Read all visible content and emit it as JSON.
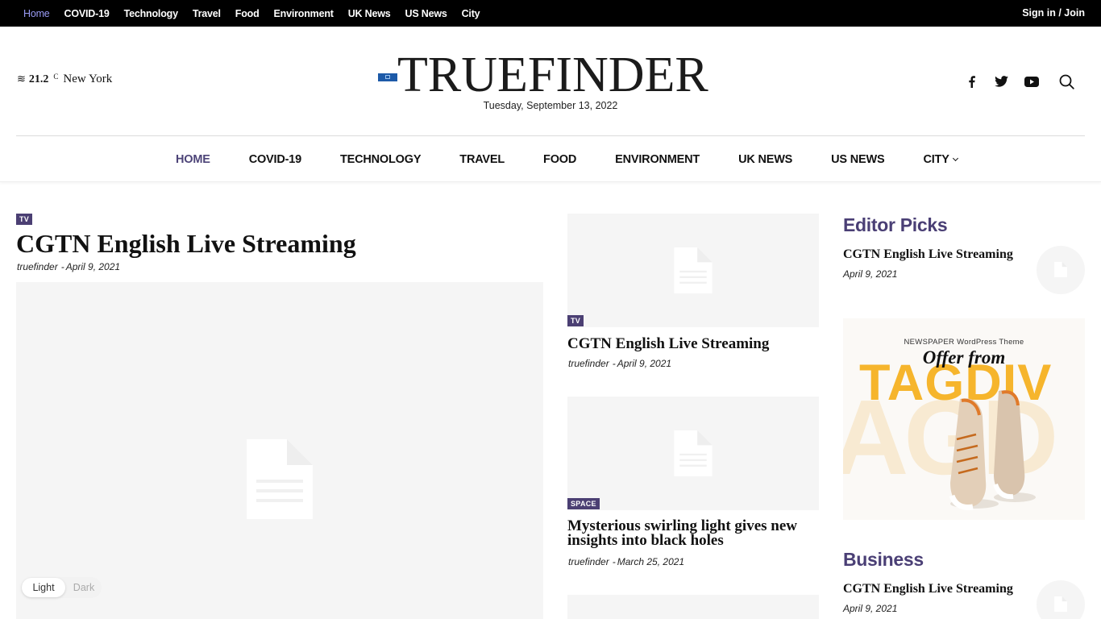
{
  "topbar": {
    "menu": [
      "Home",
      "COVID-19",
      "Technology",
      "Travel",
      "Food",
      "Environment",
      "UK News",
      "US News",
      "City"
    ],
    "signin": "Sign in / Join"
  },
  "header": {
    "weather": {
      "temp": "21.2",
      "unit": "C",
      "city": "New York",
      "icon": "wind-waves-icon"
    },
    "logo": "TRUEFINDER",
    "date": "Tuesday, September 13, 2022",
    "social": [
      "facebook-icon",
      "twitter-icon",
      "youtube-icon",
      "search-icon"
    ]
  },
  "nav": {
    "items": [
      "HOME",
      "COVID-19",
      "TECHNOLOGY",
      "TRAVEL",
      "FOOD",
      "ENVIRONMENT",
      "UK NEWS",
      "US NEWS",
      "CITY"
    ]
  },
  "featured": {
    "tag": "TV",
    "title": "CGTN English Live Streaming",
    "author": "truefinder",
    "date": "April 9, 2021"
  },
  "middle": [
    {
      "tag": "TV",
      "title": "CGTN English Live Streaming",
      "author": "truefinder",
      "date": "April 9, 2021"
    },
    {
      "tag": "SPACE",
      "title": "Mysterious swirling light gives new insights into black holes",
      "author": "truefinder",
      "date": "March 25, 2021"
    }
  ],
  "sidebar": {
    "editor_picks": {
      "heading": "Editor Picks",
      "title": "CGTN English Live Streaming",
      "date": "April 9, 2021"
    },
    "ad": {
      "small": "NEWSPAPER WordPress Theme",
      "offer": "Offer from",
      "brand": "TAGDIV",
      "bg": "AGD"
    },
    "business": {
      "heading": "Business",
      "title": "CGTN English Live Streaming",
      "date": "April 9, 2021"
    }
  },
  "theme_toggle": {
    "light": "Light",
    "dark": "Dark"
  },
  "colors": {
    "accent": "#4b3f73",
    "topbar_active": "#9a9bf5",
    "brand_yellow": "#f6b52c"
  }
}
